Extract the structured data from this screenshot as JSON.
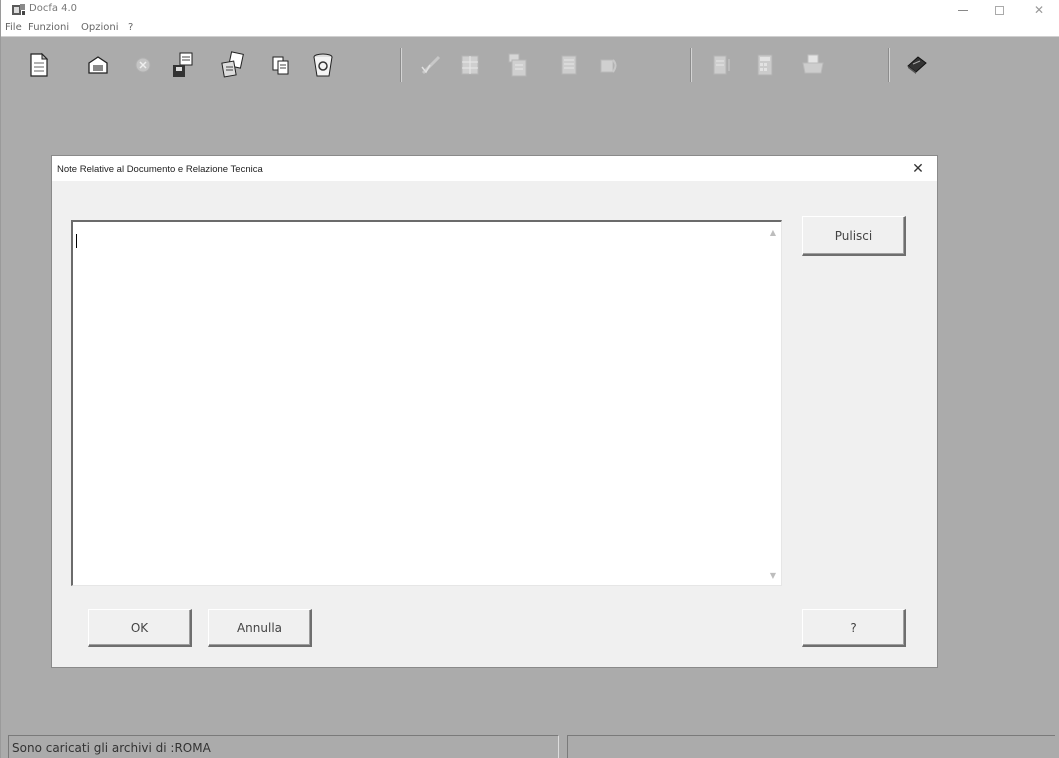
{
  "window": {
    "title": "Docfa 4.0",
    "minimize_icon": "minimize-icon",
    "maximize_icon": "maximize-icon",
    "close_glyph": "✕"
  },
  "menu": {
    "items": [
      "File",
      "Funzioni",
      "Opzioni",
      "?"
    ]
  },
  "toolbar": {
    "buttons": [
      {
        "icon": "new-document-icon",
        "enabled": true
      },
      {
        "icon": "open-folder-icon",
        "enabled": true
      },
      {
        "icon": "cancel-circle-icon",
        "enabled": false
      },
      {
        "icon": "save-disk-icon",
        "enabled": true
      },
      {
        "icon": "import-export-icon",
        "enabled": true
      },
      {
        "icon": "copy-document-icon",
        "enabled": true
      },
      {
        "icon": "recycle-bin-icon",
        "enabled": true
      },
      {
        "icon": "pencil-check-icon",
        "enabled": false
      },
      {
        "icon": "grid-form-icon",
        "enabled": false
      },
      {
        "icon": "form-list-icon",
        "enabled": false
      },
      {
        "icon": "lines-form-icon",
        "enabled": false
      },
      {
        "icon": "stack-pages-icon",
        "enabled": false
      },
      {
        "icon": "report-list-icon",
        "enabled": false
      },
      {
        "icon": "calculator-icon",
        "enabled": false
      },
      {
        "icon": "printer-icon",
        "enabled": false
      },
      {
        "icon": "help-book-icon",
        "enabled": true
      }
    ]
  },
  "dialog": {
    "title": "Note Relative al Documento e Relazione Tecnica",
    "close_glyph": "✕",
    "text_value": "",
    "pulisci_label": "Pulisci",
    "ok_label": "OK",
    "annulla_label": "Annulla",
    "help_label": "?"
  },
  "status": {
    "message": "Sono caricati gli archivi di :ROMA",
    "secondary": ""
  },
  "colors": {
    "workspace": "#ababab",
    "dialog_bg": "#f0f0f0"
  }
}
